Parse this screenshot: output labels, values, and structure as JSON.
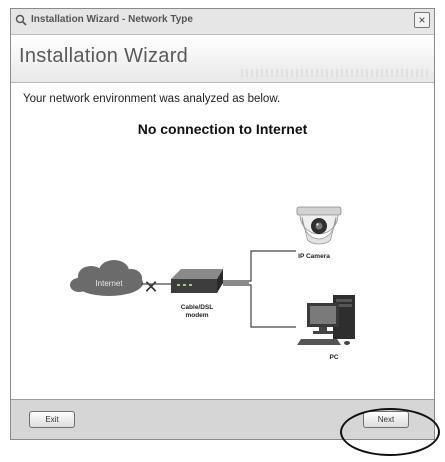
{
  "window": {
    "title": "Installation Wizard - Network Type",
    "close_glyph": "×"
  },
  "header": {
    "wizard_title": "Installation Wizard"
  },
  "content": {
    "analysis_text": "Your network environment was analyzed as below.",
    "status_text": "No connection to Internet"
  },
  "diagram": {
    "internet_label": "Internet",
    "modem_label_line1": "Cable/DSL",
    "modem_label_line2": "modem",
    "camera_label": "IP Camera",
    "pc_label": "PC",
    "disconnect_glyph": "✕"
  },
  "footer": {
    "exit_label": "Exit",
    "next_label": "Next"
  },
  "colors": {
    "window_border": "#8a8a8a",
    "footer_bg": "#d6d6d6",
    "cloud": "#6b6b6b",
    "modem": "#3d3d3d"
  }
}
